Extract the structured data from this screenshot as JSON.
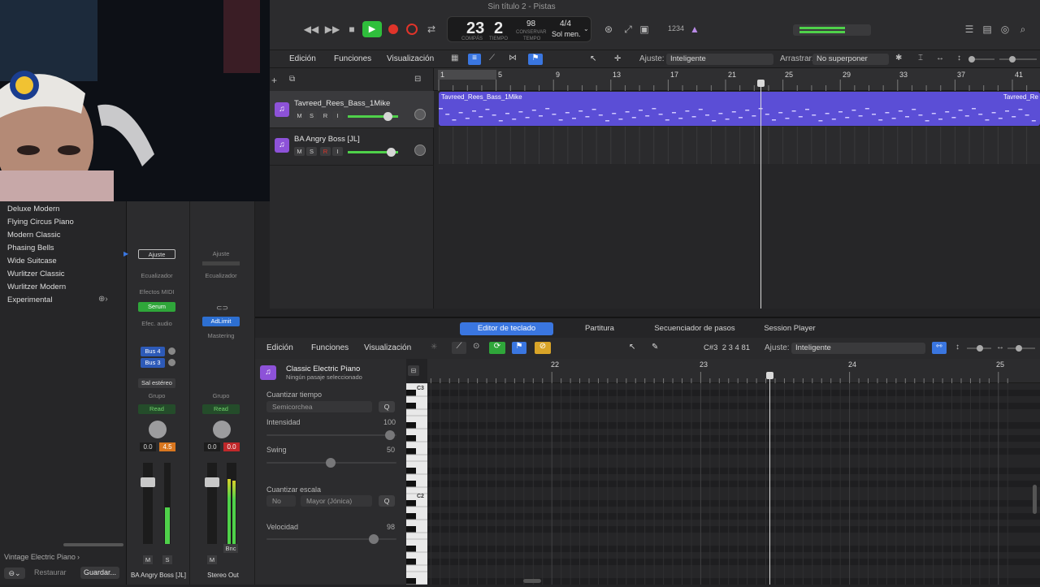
{
  "window": {
    "title": "Sin título 2 - Pistas"
  },
  "transport": {
    "bar": "23",
    "beat": "2",
    "bar_label": "COMPÁS",
    "beat_label": "TIEMPO",
    "tempo": "98",
    "tempo_mode": "CONSERVAR",
    "tempo_label": "TEMPO",
    "signature": "4/4",
    "key": "Sol men.",
    "count_in": "1234"
  },
  "tracks_header": {
    "menus": [
      "Edición",
      "Funciones",
      "Visualización"
    ],
    "snap_label": "Ajuste:",
    "snap_value": "Inteligente",
    "drag_label": "Arrastrar:",
    "drag_value": "No superponer"
  },
  "tracks": [
    {
      "name": "Tavreed_Rees_Bass_1Mike",
      "m": "M",
      "s": "S",
      "r": "R",
      "i": "I"
    },
    {
      "name": "BA Angry Boss [JL]",
      "m": "M",
      "s": "S",
      "r": "R",
      "i": "I"
    }
  ],
  "ruler": {
    "marks": [
      "1",
      "5",
      "9",
      "13",
      "17",
      "21",
      "25",
      "29",
      "33",
      "37",
      "41"
    ]
  },
  "regions": {
    "name": "Tavreed_Rees_Bass_1Mike",
    "name_end": "Tavreed_Re"
  },
  "library": {
    "items": [
      "Deluxe Modern",
      "Flying Circus Piano",
      "Modern Classic",
      "Phasing Bells",
      "Wide Suitcase",
      "Wurlitzer Classic",
      "Wurlitzer Modern",
      "Experimental"
    ],
    "footer_preset": "Vintage Electric Piano",
    "restore": "Restaurar",
    "save": "Guardar..."
  },
  "mixer": {
    "strip1": {
      "setting": "Ajuste",
      "eq": "Ecualizador",
      "midi_fx": "Efectos MIDI",
      "instrument": "Serum",
      "audio_fx": "Efec. audio",
      "bus4": "Bus 4",
      "bus3": "Bus 3",
      "output": "Sal estéreo",
      "group": "Grupo",
      "automation": "Read",
      "vol": "0.0",
      "peak": "4.5",
      "m": "M",
      "s": "S",
      "name": "BA Angry Boss [JL]"
    },
    "strip2": {
      "setting": "Ajuste",
      "eq": "Ecualizador",
      "plugin": "AdLimit",
      "mastering": "Mastering",
      "group": "Grupo",
      "automation": "Read",
      "vol": "0.0",
      "peak": "0.0",
      "m": "M",
      "bnc": "Bnc",
      "name": "Stereo Out"
    }
  },
  "editor": {
    "tabs": [
      "Editor de teclado",
      "Partitura",
      "Secuenciador de pasos",
      "Session Player"
    ],
    "active_tab": 0,
    "menus": [
      "Edición",
      "Funciones",
      "Visualización"
    ],
    "position": "C#3  2 3 4 81",
    "snap_label": "Ajuste:",
    "snap_value": "Inteligente",
    "ruler": [
      "22",
      "23",
      "24",
      "25"
    ],
    "region_title": "Classic Electric Piano",
    "region_sub": "Ningún pasaje seleccionado"
  },
  "inspector": {
    "quantize_time": "Cuantizar tiempo",
    "quantize_value": "Semicorchea",
    "q": "Q",
    "strength": "Intensidad",
    "strength_value": "100",
    "swing": "Swing",
    "swing_value": "50",
    "scale_quantize": "Cuantizar escala",
    "scale_no": "No",
    "scale_value": "Mayor (Jónica)",
    "velocity": "Velocidad",
    "velocity_value": "98"
  },
  "piano_labels": [
    "C3",
    "C2"
  ],
  "colors": {
    "accent": "#3a76e0",
    "region": "#5b4ed6",
    "play": "#2fbf3c",
    "record": "#e0342a"
  }
}
